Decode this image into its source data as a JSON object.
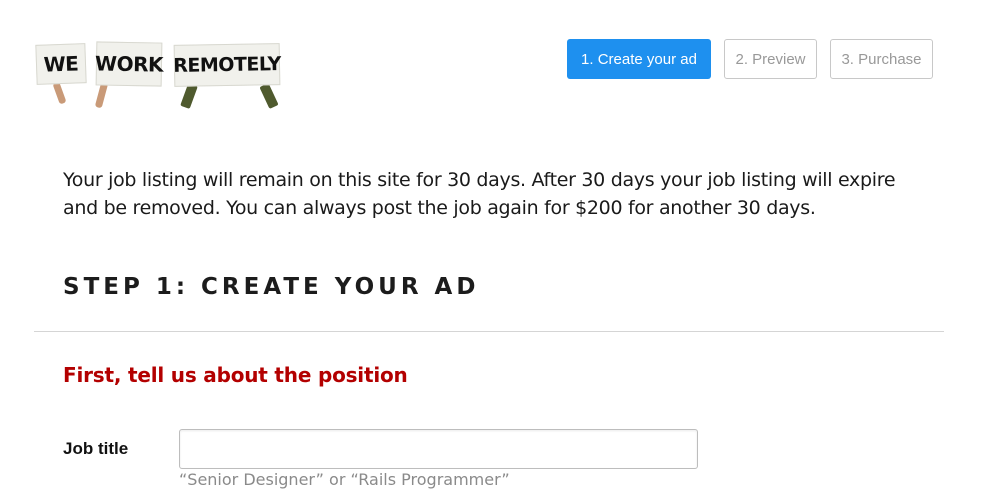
{
  "logo": {
    "alt": "We Work Remotely",
    "signs": [
      "WE",
      "WORK",
      "REMOTELY"
    ]
  },
  "steps": [
    {
      "label": "1. Create your ad",
      "active": true
    },
    {
      "label": "2. Preview",
      "active": false
    },
    {
      "label": "3. Purchase",
      "active": false
    }
  ],
  "intro": "Your job listing will remain on this site for 30 days. After 30 days your job listing will expire and be removed. You can always post the job again for $200 for another 30 days.",
  "step_heading": "STEP 1: CREATE YOUR AD",
  "subheading": "First, tell us about the position",
  "form": {
    "job_title": {
      "label": "Job title",
      "value": "",
      "hint": "“Senior Designer” or “Rails Programmer”"
    }
  },
  "colors": {
    "accent": "#1e90ef",
    "subheading": "#b30000",
    "hint": "#8a8a8a"
  }
}
